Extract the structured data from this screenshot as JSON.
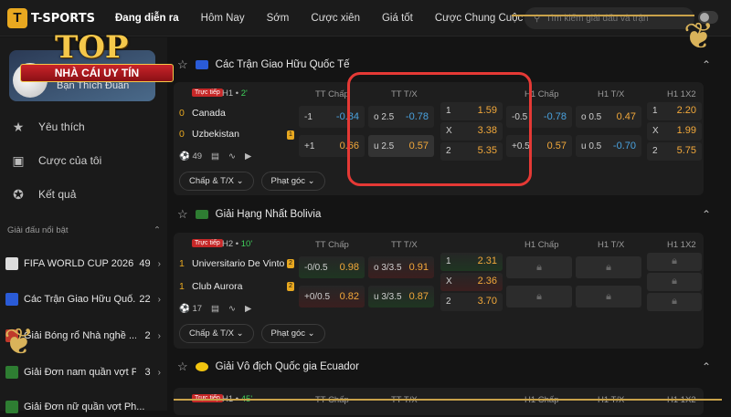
{
  "nav": {
    "brand": "T-SPORTS",
    "items": [
      "Đang diễn ra",
      "Hôm Nay",
      "Sớm",
      "Cược xiên",
      "Giá tốt",
      "Cược Chung Cuộc"
    ],
    "search_placeholder": "Tìm kiếm giải đấu và trận"
  },
  "overlay": {
    "line1": "TOP",
    "line2": "NHÀ CÁI UY TÍN"
  },
  "sidebar": {
    "profile_name": "Bạn Thích Đuân",
    "items": [
      {
        "label": "Yêu thích",
        "icon": "star-icon"
      },
      {
        "label": "Cược của tôi",
        "icon": "ticket-icon"
      },
      {
        "label": "Kết quả",
        "icon": "medal-icon"
      }
    ],
    "section_title": "Giải đấu nổi bật",
    "leagues": [
      {
        "name": "FIFA WORLD CUP 2026",
        "count": "49"
      },
      {
        "name": "Các Trận Giao Hữu Quố...",
        "count": "22"
      },
      {
        "name": "Giải Bóng rổ Nhà nghề ...",
        "count": "2"
      },
      {
        "name": "Giải Đơn nam quần vợt P...",
        "count": "3"
      },
      {
        "name": "Giải Đơn nữ quần vợt Ph...",
        "count": ""
      }
    ]
  },
  "colors": {
    "accent": "#e8a820",
    "odd_orange": "#f2a83a",
    "odd_blue": "#4aa3e0",
    "live": "#c62828",
    "highlight": "#e53935"
  },
  "headers": {
    "tt_chap": "TT Chấp",
    "tt_tx": "TT T/X",
    "h1_chap": "H1 Chấp",
    "h1_tx": "H1 T/X",
    "h1_1x2": "H1 1X2"
  },
  "sections": [
    {
      "title": "Các Trận Giao Hữu Quốc Tế",
      "live": "Trực tiếp",
      "half": "H1 •",
      "minute": "2'",
      "teams": [
        {
          "score": "0",
          "name": "Canada"
        },
        {
          "score": "0",
          "name": "Uzbekistan",
          "card": "1"
        }
      ],
      "meta": "49",
      "tabs": [
        "Chấp & T/X",
        "Phạt góc"
      ],
      "tt_chap": [
        {
          "l": "-1",
          "o": "-0.84"
        },
        {
          "l": "+1",
          "o": "0.66"
        }
      ],
      "tt_tx": [
        {
          "l": "o 2.5",
          "o": "-0.78"
        },
        {
          "l": "u 2.5",
          "o": "0.57"
        }
      ],
      "x12": [
        {
          "l": "1",
          "o": "1.59"
        },
        {
          "l": "X",
          "o": "3.38"
        },
        {
          "l": "2",
          "o": "5.35"
        }
      ],
      "h1_chap": [
        {
          "l": "-0.5",
          "o": "-0.78"
        },
        {
          "l": "+0.5",
          "o": "0.57"
        }
      ],
      "h1_tx": [
        {
          "l": "o 0.5",
          "o": "0.47"
        },
        {
          "l": "u 0.5",
          "o": "-0.70"
        }
      ],
      "h1_1x2": [
        {
          "l": "1",
          "o": "2.20"
        },
        {
          "l": "X",
          "o": "1.99"
        },
        {
          "l": "2",
          "o": "5.75"
        }
      ]
    },
    {
      "title": "Giải Hạng Nhất Bolivia",
      "live": "Trực tiếp",
      "half": "H2 •",
      "minute": "10'",
      "teams": [
        {
          "score": "1",
          "name": "Universitario De Vinto",
          "card": "2"
        },
        {
          "score": "1",
          "name": "Club Aurora",
          "card": "2"
        }
      ],
      "meta": "17",
      "tabs": [
        "Chấp & T/X",
        "Phạt góc"
      ],
      "tt_chap": [
        {
          "l": "-0/0.5",
          "o": "0.98"
        },
        {
          "l": "+0/0.5",
          "o": "0.82"
        }
      ],
      "tt_tx": [
        {
          "l": "o 3/3.5",
          "o": "0.91"
        },
        {
          "l": "u 3/3.5",
          "o": "0.87"
        }
      ],
      "x12": [
        {
          "l": "1",
          "o": "2.31"
        },
        {
          "l": "X",
          "o": "2.36"
        },
        {
          "l": "2",
          "o": "3.70"
        }
      ]
    },
    {
      "title": "Giải Vô địch Quốc gia Ecuador",
      "live": "Trực tiếp",
      "half": "H1 •",
      "minute": "45'"
    }
  ]
}
